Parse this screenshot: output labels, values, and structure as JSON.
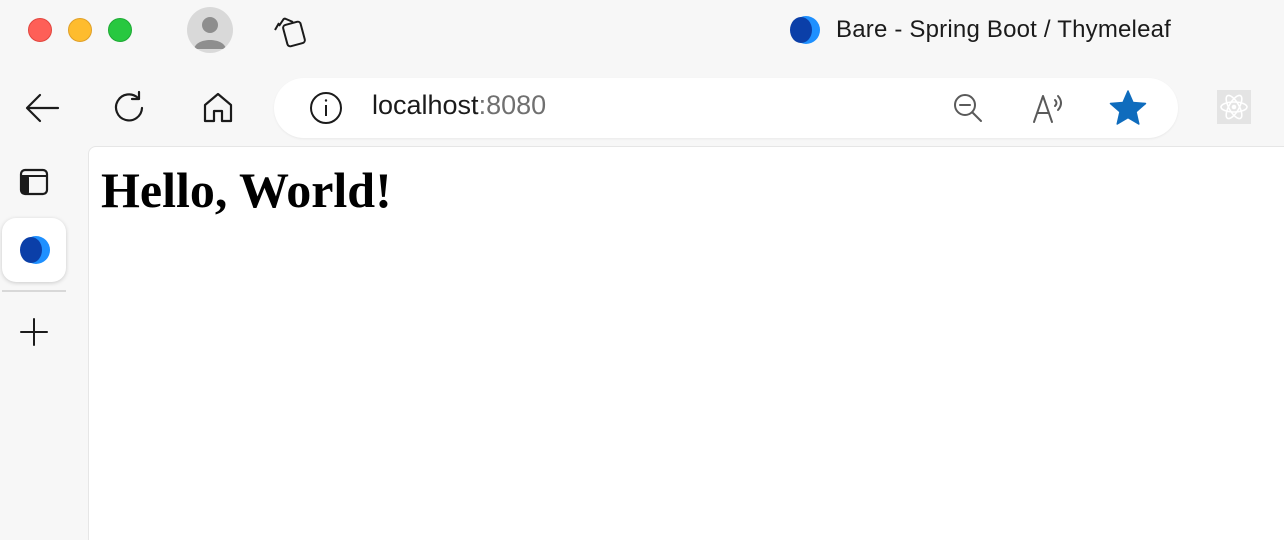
{
  "window": {
    "title": "Bare - Spring Boot / Thymeleaf",
    "favicon": "edge-logo-icon"
  },
  "toolbar": {
    "back": "back-arrow-icon",
    "refresh": "refresh-icon",
    "home": "home-icon",
    "address": {
      "host": "localhost",
      "port": ":8080",
      "info": "info-icon",
      "zoom": "zoom-out-icon",
      "read_aloud": "read-aloud-icon",
      "favorite": "star-icon"
    },
    "extension": "react-devtools-icon"
  },
  "sidebar": {
    "items": [
      {
        "icon": "tab-actions-icon"
      },
      {
        "icon": "edge-logo-icon",
        "active": true
      },
      {
        "icon": "plus-icon"
      }
    ]
  },
  "page": {
    "heading": "Hello, World!"
  },
  "colors": {
    "accent": "#0f6cbd",
    "close": "#fe5f57",
    "minimize": "#febc2e",
    "zoom": "#28c840"
  }
}
